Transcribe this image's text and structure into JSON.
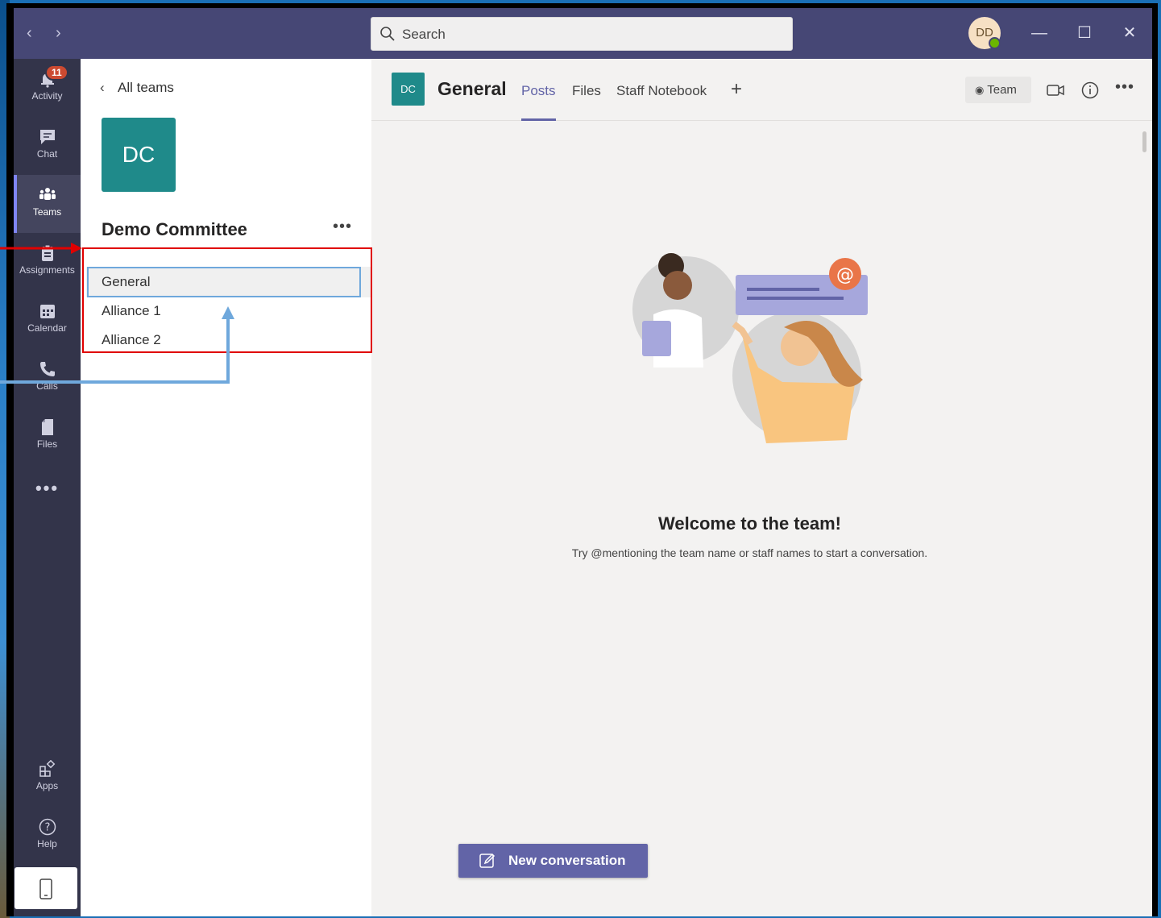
{
  "titlebar": {
    "search_placeholder": "Search",
    "avatar_initials": "DD",
    "minimize": "—",
    "maximize": "☐",
    "close": "✕"
  },
  "rail": {
    "items": [
      {
        "label": "Activity",
        "icon": "bell-icon",
        "badge": "11"
      },
      {
        "label": "Chat",
        "icon": "chat-icon"
      },
      {
        "label": "Teams",
        "icon": "teams-icon",
        "active": true
      },
      {
        "label": "Assignments",
        "icon": "assignments-icon"
      },
      {
        "label": "Calendar",
        "icon": "calendar-icon"
      },
      {
        "label": "Calls",
        "icon": "phone-icon"
      },
      {
        "label": "Files",
        "icon": "file-icon"
      }
    ],
    "more": "•••",
    "apps_label": "Apps",
    "help_label": "Help"
  },
  "sidepanel": {
    "back_label": "All teams",
    "team_initials": "DC",
    "team_name": "Demo Committee",
    "more": "•••",
    "channels": [
      "General",
      "Alliance 1",
      "Alliance 2"
    ]
  },
  "main": {
    "channel_initials": "DC",
    "channel_title": "General",
    "tabs": [
      "Posts",
      "Files",
      "Staff Notebook"
    ],
    "team_pill": "Team",
    "more": "•••",
    "welcome_title": "Welcome to the team!",
    "welcome_sub": "Try @mentioning the team name or staff names to start a conversation.",
    "new_conversation": "New conversation"
  },
  "colors": {
    "titlebar": "#464775",
    "rail": "#33344a",
    "accent": "#6264a7",
    "team_tile": "#1f8a8a",
    "annotation_red": "#e00000",
    "annotation_blue": "#6fa8dc"
  }
}
